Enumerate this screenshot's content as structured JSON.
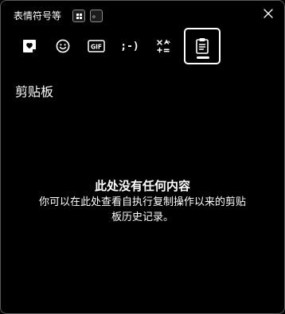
{
  "header": {
    "title": "表情符号等",
    "key_period": "。"
  },
  "tabs": [
    {
      "name": "heart-icon"
    },
    {
      "name": "smiley-icon"
    },
    {
      "name": "gif-icon",
      "label": "GIF"
    },
    {
      "name": "kaomoji-icon",
      "label": ";-)"
    },
    {
      "name": "symbols-icon"
    },
    {
      "name": "clipboard-icon",
      "selected": true
    }
  ],
  "section": {
    "title": "剪贴板"
  },
  "empty_state": {
    "title": "此处没有任何内容",
    "description": "你可以在此处查看自执行复制操作以来的剪贴板历史记录。"
  },
  "colors": {
    "background": "#000000",
    "foreground": "#ffffff",
    "border": "#5a5a5a"
  }
}
